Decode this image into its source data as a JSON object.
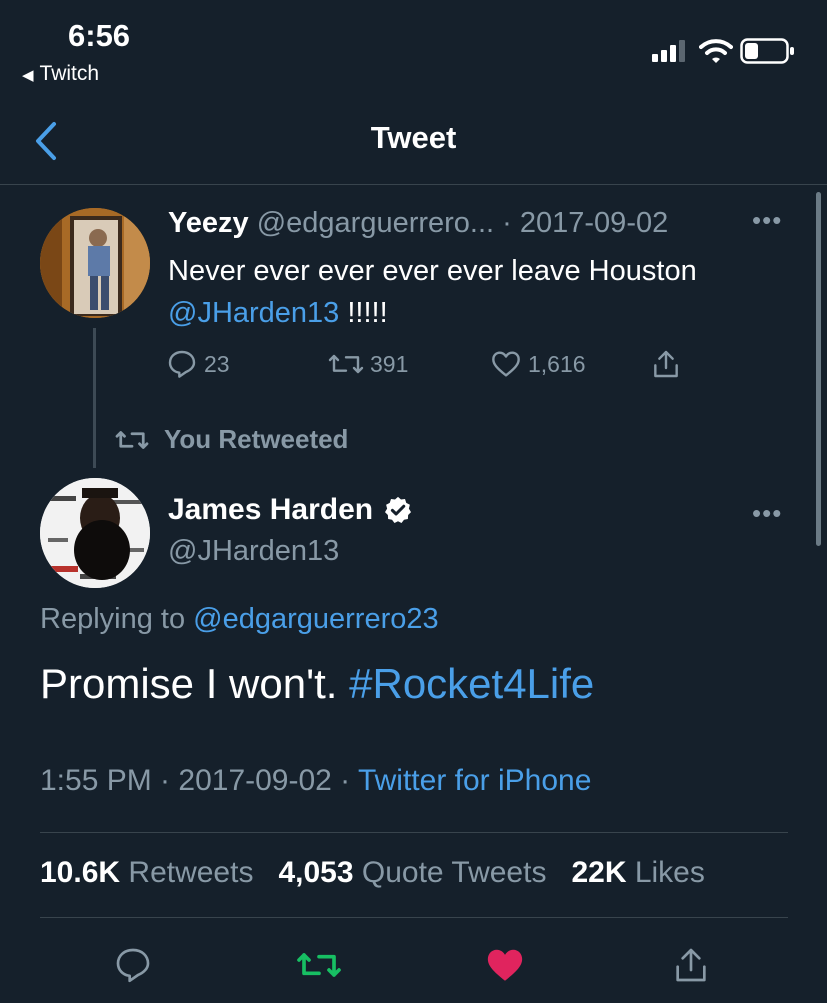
{
  "status_bar": {
    "time": "6:56",
    "back_app": "Twitch"
  },
  "nav": {
    "title": "Tweet"
  },
  "parent_tweet": {
    "display_name": "Yeezy",
    "handle": "@edgarguerrero...",
    "date": "· 2017-09-02",
    "text": "Never ever ever ever ever leave Houston",
    "mention": "@JHarden13",
    "text_tail": " !!!!!",
    "replies": "23",
    "retweets": "391",
    "likes": "1,616"
  },
  "retweet_indicator": "You Retweeted",
  "main_tweet": {
    "display_name": "James Harden",
    "handle": "@JHarden13",
    "replying_prefix": "Replying to ",
    "replying_to": "@edgarguerrero23",
    "text": "Promise I won't. ",
    "hashtag": "#Rocket4Life",
    "time": "1:55 PM · 2017-09-02 · ",
    "source": "Twitter for iPhone",
    "stats": {
      "retweets_count": "10.6K",
      "retweets_label": " Retweets",
      "quotes_count": "4,053",
      "quotes_label": " Quote Tweets",
      "likes_count": "22K",
      "likes_label": " Likes"
    }
  },
  "colors": {
    "background": "#15202b",
    "link": "#4a9fe8",
    "muted": "#8899a6",
    "retweet_active": "#17bf63",
    "like_active": "#e0245e"
  }
}
